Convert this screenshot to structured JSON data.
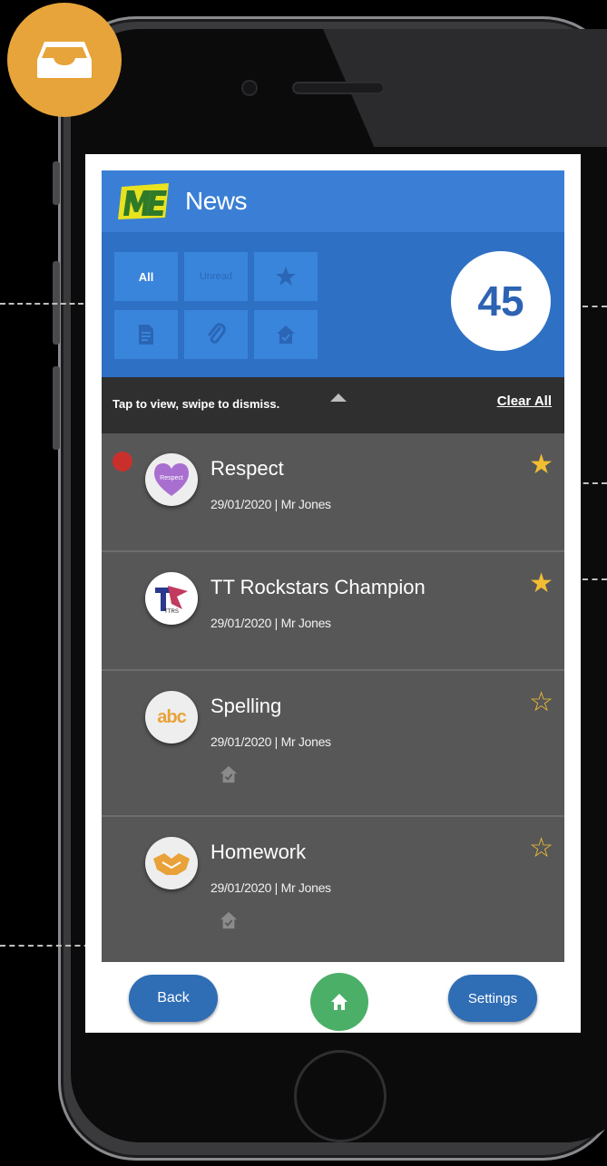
{
  "header": {
    "title": "News"
  },
  "filters": {
    "all": "All",
    "unread": "Unread",
    "icons": [
      "star-icon",
      "document-icon",
      "paperclip-icon",
      "home-icon"
    ]
  },
  "count": "45",
  "hint": {
    "text": "Tap to view, swipe to dismiss.",
    "clear_all": "Clear All"
  },
  "items": [
    {
      "title": "Respect",
      "meta": "29/01/2020 | Mr Jones",
      "avatar_label": "Respect",
      "starred": true,
      "unread": true,
      "homework_icon": false
    },
    {
      "title": "TT Rockstars Champion",
      "meta": "29/01/2020 | Mr Jones",
      "avatar_label": "TTRS",
      "starred": true,
      "unread": false,
      "homework_icon": false
    },
    {
      "title": "Spelling",
      "meta": "29/01/2020 | Mr Jones",
      "avatar_label": "abc",
      "starred": false,
      "unread": false,
      "homework_icon": true
    },
    {
      "title": "Homework",
      "meta": "29/01/2020 | Mr Jones",
      "avatar_label": "",
      "starred": false,
      "unread": false,
      "homework_icon": true
    }
  ],
  "footer": {
    "back": "Back",
    "settings": "Settings"
  },
  "colors": {
    "accent": "#3a7fd5",
    "badge": "#e7a43b",
    "star": "#f2bd33",
    "unread": "#c9302c",
    "home": "#4caf68"
  }
}
